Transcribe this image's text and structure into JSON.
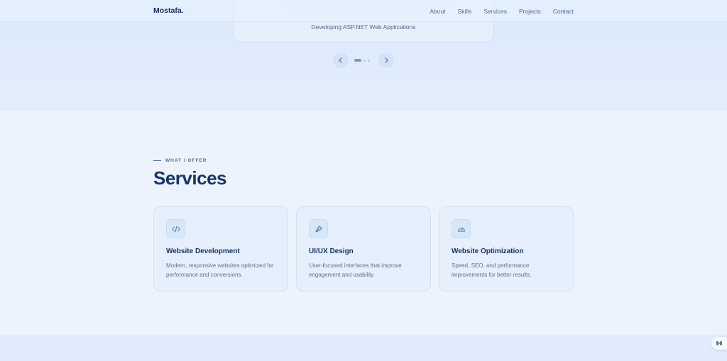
{
  "nav": {
    "logo": "Mostafa.",
    "links": [
      "About",
      "Skills",
      "Services",
      "Projects",
      "Contact"
    ]
  },
  "hero": {
    "slide_caption": "Developing ASP.NET Web Applications",
    "prev_icon": "chevron-left-icon",
    "next_icon": "chevron-right-icon",
    "dots_total": 3,
    "active_dot": 1
  },
  "services": {
    "eyebrow": "WHAT I OFFER",
    "title": "Services",
    "cards": [
      {
        "icon": "code-icon",
        "title": "Website Development",
        "description": "Modern, responsive websites optimized for performance and conversions."
      },
      {
        "icon": "pen-tool-icon",
        "title": "UI/UX Design",
        "description": "User-focused interfaces that improve engagement and usability."
      },
      {
        "icon": "gauge-icon",
        "title": "Website Optimization",
        "description": "Speed, SEO, and performance improvements for better results."
      }
    ]
  },
  "colors": {
    "accent": "#17346a",
    "muted_text": "#5b7099",
    "background": "#edf3fd"
  }
}
